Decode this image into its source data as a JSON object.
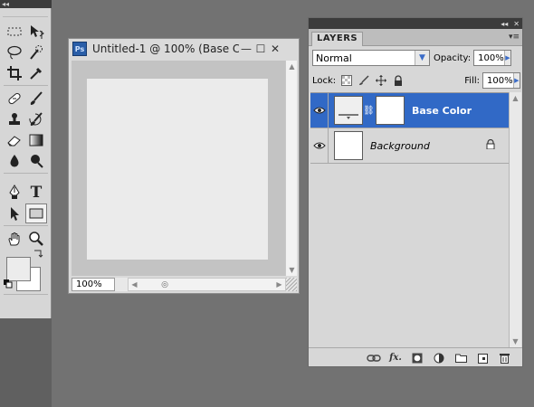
{
  "tools_panel": {
    "header_glyph": "◂◂",
    "tools": [
      {
        "name": "marquee-tool-icon",
        "active": false
      },
      {
        "name": "move-tool-icon",
        "active": false
      },
      {
        "name": "lasso-tool-icon",
        "active": false
      },
      {
        "name": "quick-selection-tool-icon",
        "active": false
      },
      {
        "name": "crop-tool-icon",
        "active": false
      },
      {
        "name": "eyedropper-tool-icon",
        "active": false
      },
      {
        "name": "healing-brush-tool-icon",
        "active": false
      },
      {
        "name": "brush-tool-icon",
        "active": false
      },
      {
        "name": "clone-stamp-tool-icon",
        "active": false
      },
      {
        "name": "history-brush-tool-icon",
        "active": false
      },
      {
        "name": "eraser-tool-icon",
        "active": false
      },
      {
        "name": "gradient-tool-icon",
        "active": false
      },
      {
        "name": "blur-tool-icon",
        "active": false
      },
      {
        "name": "dodge-tool-icon",
        "active": false
      },
      {
        "name": "pen-tool-icon",
        "active": false
      },
      {
        "name": "type-tool-icon",
        "active": false
      },
      {
        "name": "path-selection-tool-icon",
        "active": false
      },
      {
        "name": "rectangle-tool-icon",
        "active": true
      },
      {
        "name": "hand-tool-icon",
        "active": false
      },
      {
        "name": "zoom-tool-icon",
        "active": false
      }
    ],
    "type_tool_glyph": "T",
    "foreground_color": "#ececec",
    "background_color": "#ffffff"
  },
  "document": {
    "app_badge": "Ps",
    "title": "Untitled-1 @ 100% (Base C...",
    "minimize_glyph": "—",
    "maximize_glyph": "☐",
    "close_glyph": "✕",
    "zoom_level": "100%"
  },
  "layers_panel": {
    "tab_label": "LAYERS",
    "blend_mode": "Normal",
    "opacity_label": "Opacity:",
    "opacity_value": "100%",
    "lock_label": "Lock:",
    "fill_label": "Fill:",
    "fill_value": "100%",
    "layers": [
      {
        "name": "Base Color",
        "selected": true,
        "has_mask": true,
        "locked": false
      },
      {
        "name": "Background",
        "selected": false,
        "has_mask": false,
        "locked": true
      }
    ]
  },
  "colors": {
    "selection_blue": "#3169c6",
    "workspace_gray": "#727272"
  }
}
